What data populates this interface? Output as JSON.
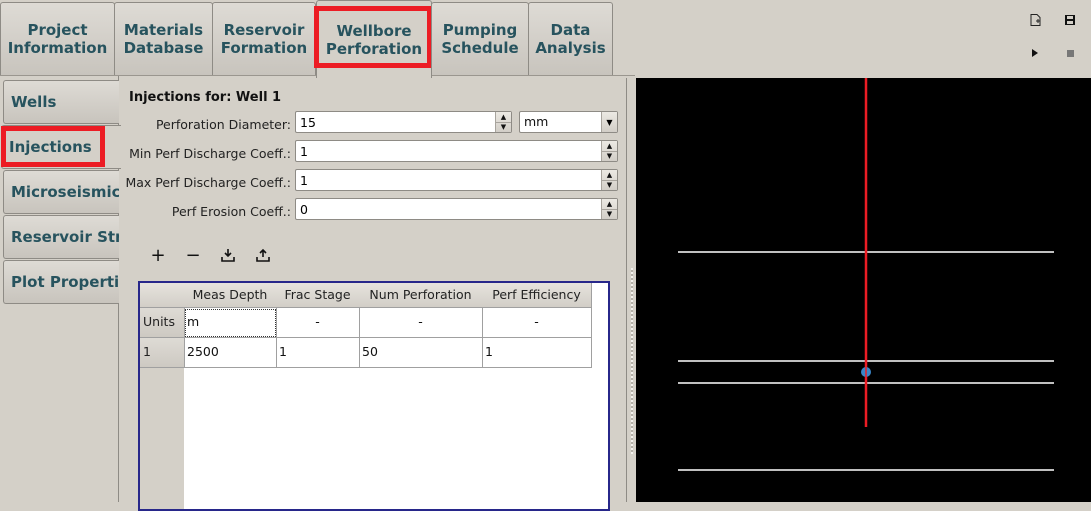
{
  "top_tabs": [
    {
      "line1": "Project",
      "line2": "Information",
      "active": false
    },
    {
      "line1": "Materials",
      "line2": "Database",
      "active": false
    },
    {
      "line1": "Reservoir",
      "line2": "Formation",
      "active": false
    },
    {
      "line1": "Wellbore",
      "line2": "Perforation",
      "active": true
    },
    {
      "line1": "Pumping",
      "line2": "Schedule",
      "active": false
    },
    {
      "line1": "Data",
      "line2": "Analysis",
      "active": false
    }
  ],
  "toolbar": {
    "icons": [
      "new-document-icon",
      "save-icon",
      "run-icon",
      "stop-icon"
    ]
  },
  "side_tabs": [
    {
      "label": "Wells",
      "active": false
    },
    {
      "label": "Injections",
      "active": true
    },
    {
      "label": "Microseismic",
      "active": false
    },
    {
      "label": "Reservoir Stre",
      "active": false
    },
    {
      "label": "Plot Propertie",
      "active": false
    }
  ],
  "form": {
    "title": "Injections for: Well 1",
    "fields": [
      {
        "label": "Perforation Diameter:",
        "value": "15"
      },
      {
        "label": "Min Perf Discharge Coeff.:",
        "value": "1"
      },
      {
        "label": "Max Perf Discharge Coeff.:",
        "value": "1"
      },
      {
        "label": "Perf Erosion Coeff.:",
        "value": "0"
      }
    ],
    "diameter_unit": "mm"
  },
  "table_toolbar": {
    "add": "+",
    "remove": "−",
    "import": "⤓",
    "export": "⤒"
  },
  "table": {
    "columns": [
      "Meas Depth",
      "Frac Stage",
      "Num Perforation",
      "Perf Efficiency"
    ],
    "units_row_label": "Units",
    "units": [
      "m",
      "-",
      "-",
      "-"
    ],
    "rows": [
      {
        "label": "1",
        "values": [
          "2500",
          "1",
          "50",
          "1"
        ]
      }
    ]
  },
  "plot": {
    "well_color": "#ec1c24",
    "layer_color": "#ffffff",
    "perforation_color": "#3a86c8",
    "background": "#000000"
  }
}
